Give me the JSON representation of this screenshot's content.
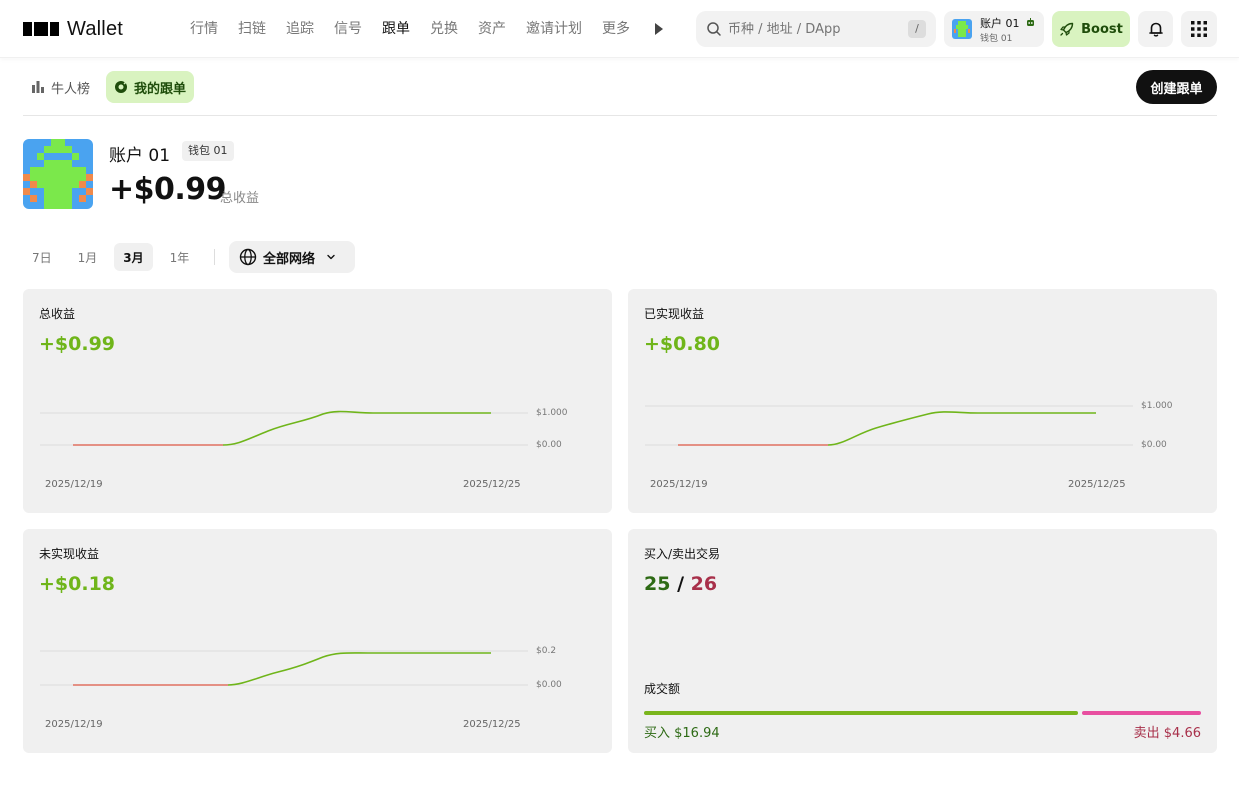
{
  "header": {
    "logo_text": "Wallet",
    "nav": [
      "行情",
      "扫链",
      "追踪",
      "信号",
      "跟单",
      "兑换",
      "资产",
      "邀请计划",
      "更多"
    ],
    "active_nav": 4,
    "search_placeholder": "币种 / 地址 / DApp",
    "search_shortcut": "/",
    "account_name": "账户 01",
    "account_wallet": "钱包 01",
    "boost_label": "Boost"
  },
  "subtabs": [
    {
      "label": "牛人榜",
      "icon": "bar-chart-icon"
    },
    {
      "label": "我的跟单",
      "icon": "copy-trade-icon"
    }
  ],
  "active_subtab": 1,
  "create_button": "创建跟单",
  "profile": {
    "name": "账户 01",
    "wallet_tag": "钱包 01",
    "total": "+$0.99",
    "total_label": "总收益"
  },
  "filters": {
    "periods": [
      "7日",
      "1月",
      "3月",
      "1年"
    ],
    "active_period": 2,
    "network_label": "全部网络"
  },
  "cards": {
    "total": {
      "title": "总收益",
      "value": "+$0.99",
      "y_labels": [
        "$1.000",
        "$0.00"
      ],
      "x_labels": [
        "2025/12/19",
        "2025/12/25"
      ]
    },
    "realized": {
      "title": "已实现收益",
      "value": "+$0.80",
      "y_labels": [
        "$1.000",
        "$0.00"
      ],
      "x_labels": [
        "2025/12/19",
        "2025/12/25"
      ]
    },
    "unrealized": {
      "title": "未实现收益",
      "value": "+$0.18",
      "y_labels": [
        "$0.2",
        "$0.00"
      ],
      "x_labels": [
        "2025/12/19",
        "2025/12/25"
      ]
    },
    "trades": {
      "title": "买入/卖出交易",
      "buy_count": "25",
      "separator": "/",
      "sell_count": "26",
      "volume_title": "成交额",
      "buy_label": "买入 $16.94",
      "sell_label": "卖出 $4.66",
      "buy_share": 0.784
    }
  },
  "colors": {
    "accent_green": "#6fb51a",
    "negative_red": "#e07060",
    "sell_pink": "#e84fa0",
    "boost_bg": "#d9f3c0"
  }
}
